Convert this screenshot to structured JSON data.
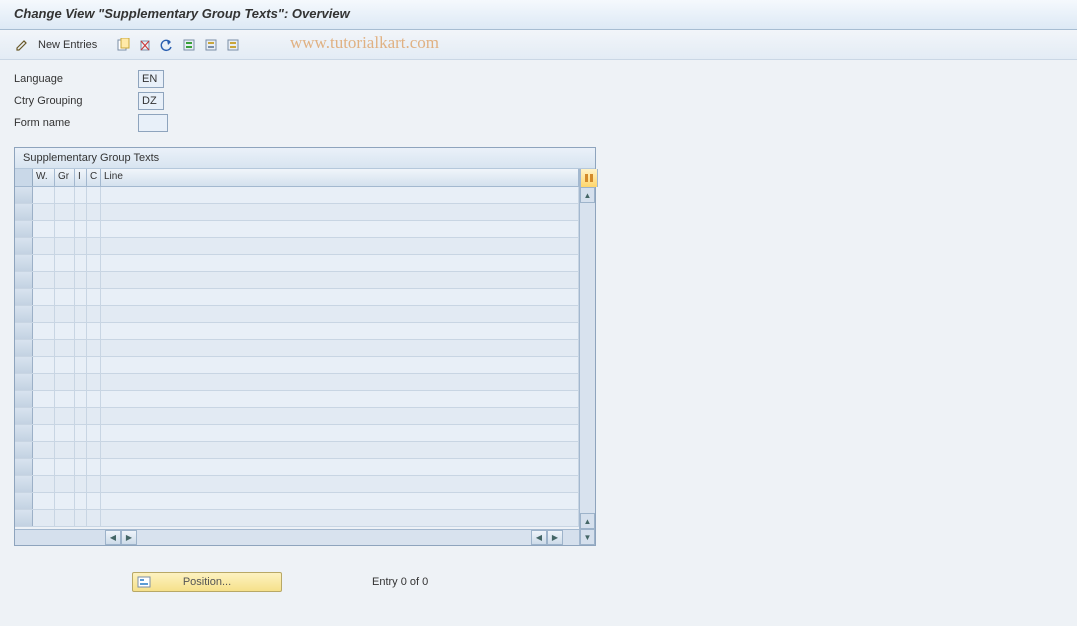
{
  "title": "Change View \"Supplementary Group Texts\": Overview",
  "toolbar": {
    "new_entries_label": "New Entries"
  },
  "watermark": "www.tutorialkart.com",
  "fields": {
    "language_label": "Language",
    "language_value": "EN",
    "ctry_grouping_label": "Ctry Grouping",
    "ctry_grouping_value": "DZ",
    "form_name_label": "Form name",
    "form_name_value": ""
  },
  "table": {
    "panel_title": "Supplementary Group Texts",
    "columns": {
      "w": "W.",
      "gr": "Gr",
      "i": "I",
      "c": "C",
      "line": "Line"
    },
    "rows": [
      {},
      {},
      {},
      {},
      {},
      {},
      {},
      {},
      {},
      {},
      {},
      {},
      {},
      {},
      {},
      {},
      {},
      {},
      {},
      {}
    ]
  },
  "footer": {
    "position_label": "Position...",
    "entry_text": "Entry 0 of 0"
  }
}
